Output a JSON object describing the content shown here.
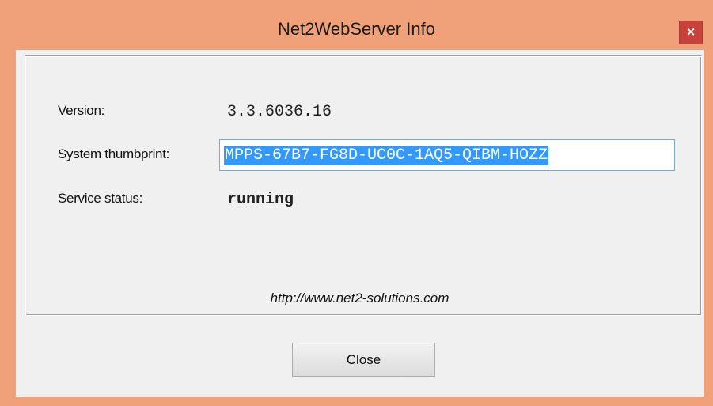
{
  "window": {
    "title": "Net2WebServer Info",
    "close_glyph": "×"
  },
  "info": {
    "version_label": "Version:",
    "version_value": "3.3.6036.16",
    "thumbprint_label": "System thumbprint:",
    "thumbprint_value": "MPPS-67B7-FG8D-UC0C-1AQ5-QIBM-HOZZ",
    "status_label": "Service status:",
    "status_value": "running"
  },
  "footer": {
    "link": "http://www.net2-solutions.com",
    "close_button": "Close"
  },
  "colors": {
    "title_bar": "#f1a17a",
    "close_button_bg": "#c8413a",
    "selection": "#3399ff",
    "client_bg": "#f0f0f0"
  }
}
